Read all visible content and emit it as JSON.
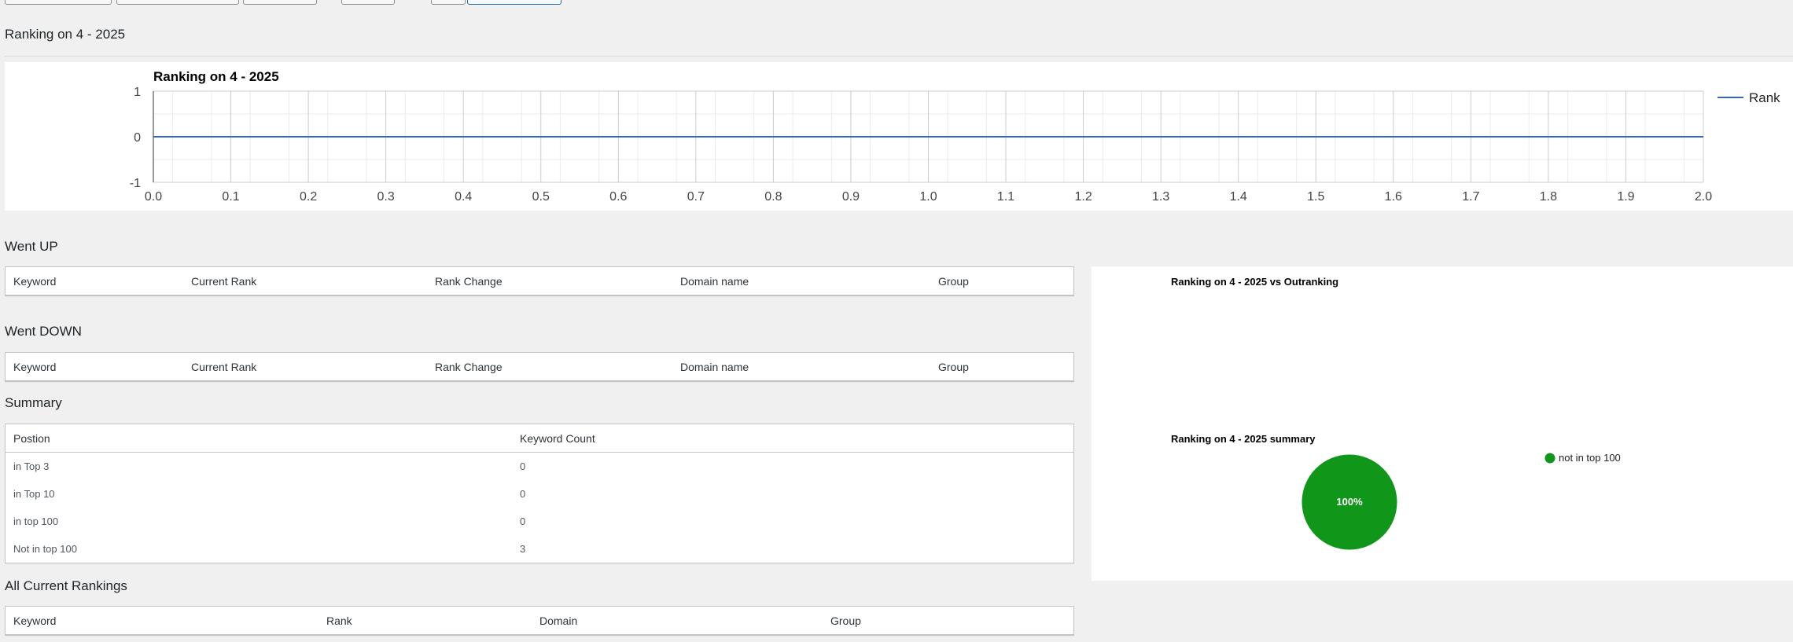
{
  "page": {
    "header_title": "Ranking on 4 - 2025"
  },
  "rank_chart": {
    "title": "Ranking on 4 - 2025",
    "legend_label": "Rank",
    "line_color": "#3366cc"
  },
  "chart_data": [
    {
      "type": "line",
      "title": "Ranking on 4 - 2025",
      "x_ticks": [
        "0.0",
        "0.1",
        "0.2",
        "0.3",
        "0.4",
        "0.5",
        "0.6",
        "0.7",
        "0.8",
        "0.9",
        "1.0",
        "1.1",
        "1.2",
        "1.3",
        "1.4",
        "1.5",
        "1.6",
        "1.7",
        "1.8",
        "1.9",
        "2.0"
      ],
      "y_ticks": [
        "1",
        "0",
        "-1"
      ],
      "xlim": [
        0,
        2
      ],
      "ylim": [
        -1,
        1
      ],
      "grid": true,
      "legend_position": "right",
      "series": [
        {
          "name": "Rank",
          "x": [
            0,
            2
          ],
          "y": [
            0,
            0
          ],
          "color": "#3366cc"
        }
      ]
    },
    {
      "type": "pie",
      "title": "Ranking on 4 - 2025 summary",
      "legend_position": "right",
      "slices": [
        {
          "label": "not in top 100",
          "value": 100,
          "display": "100%",
          "color": "#109618"
        }
      ]
    }
  ],
  "went_up": {
    "title": "Went UP",
    "columns": [
      "Keyword",
      "Current Rank",
      "Rank Change",
      "Domain name",
      "Group"
    ]
  },
  "went_down": {
    "title": "Went DOWN",
    "columns": [
      "Keyword",
      "Current Rank",
      "Rank Change",
      "Domain name",
      "Group"
    ]
  },
  "summary": {
    "title": "Summary",
    "columns": [
      "Postion",
      "Keyword Count"
    ],
    "rows": [
      {
        "position": "in Top 3",
        "count": "0"
      },
      {
        "position": "in Top 10",
        "count": "0"
      },
      {
        "position": "in top 100",
        "count": "0"
      },
      {
        "position": "Not in top 100",
        "count": "3"
      }
    ]
  },
  "all_current": {
    "title": "All Current Rankings",
    "columns": [
      "Keyword",
      "Rank",
      "Domain",
      "Group"
    ]
  },
  "vs_chart": {
    "title": "Ranking on 4 - 2025 vs Outranking"
  },
  "summary_chart": {
    "title": "Ranking on 4 - 2025 summary",
    "slice_label": "100%",
    "legend_label": "not in top 100",
    "slice_color": "#109618"
  }
}
